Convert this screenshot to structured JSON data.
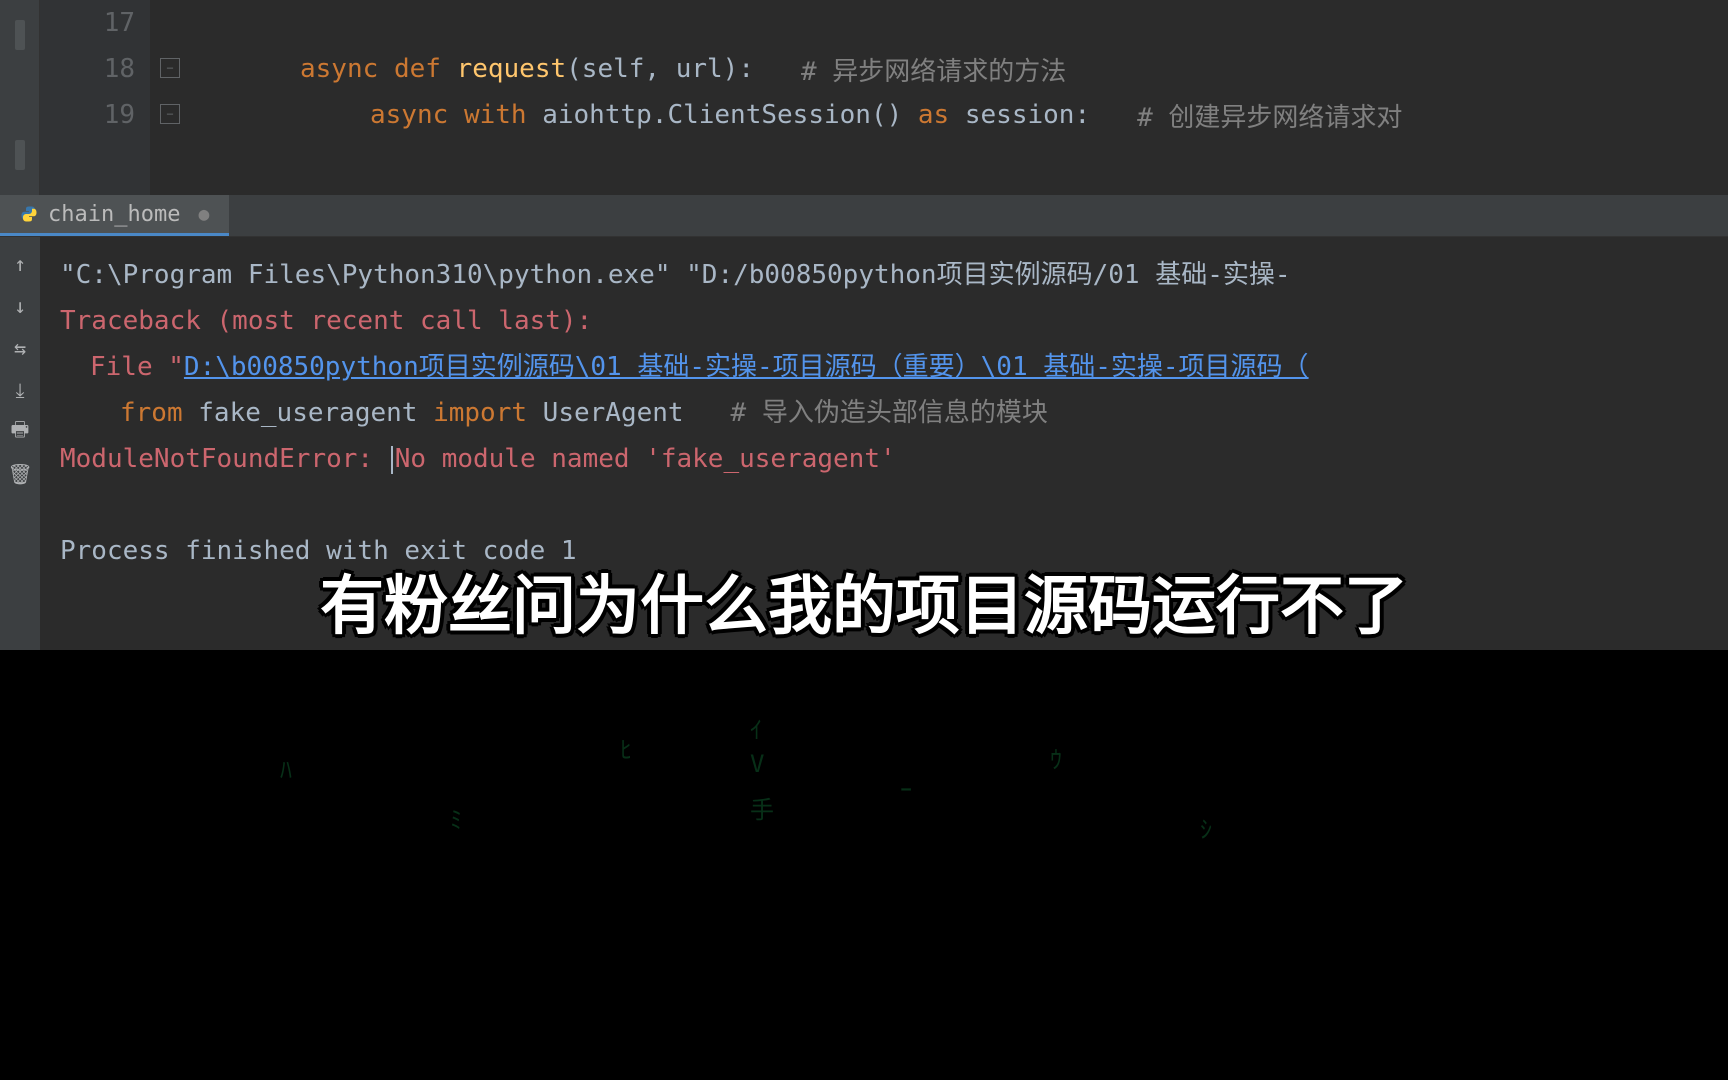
{
  "editor": {
    "lines": [
      {
        "num": "17",
        "content": ""
      },
      {
        "num": "18",
        "content": "async def request(self, url):  # 异步网络请求的方法"
      },
      {
        "num": "19",
        "content": "async with aiohttp.ClientSession() as session:  # 创建异步网络请求对"
      }
    ],
    "tokens": {
      "line18": {
        "async": "async",
        "def": "def",
        "fn": "request",
        "params": "(self, url):",
        "comment": "# 异步网络请求的方法"
      },
      "line19": {
        "async": "async",
        "with": "with",
        "call": "aiohttp.ClientSession()",
        "as": "as",
        "var": "session:",
        "comment": "# 创建异步网络请求对"
      }
    }
  },
  "tab": {
    "name": "chain_home"
  },
  "console": {
    "command": "\"C:\\Program Files\\Python310\\python.exe\" \"D:/b00850python项目实例源码/01 基础-实操-",
    "traceback": "Traceback (most recent call last):",
    "file_prefix": "File \"",
    "file_path": "D:\\b00850python项目实例源码\\01 基础-实操-项目源码（重要）\\01 基础-实操-项目源码（",
    "import_from": "from",
    "import_module": "fake_useragent",
    "import_kw": "import",
    "import_class": "UserAgent",
    "import_comment": "# 导入伪造头部信息的模块",
    "error_name": "ModuleNotFoundError:",
    "error_msg": "No module named 'fake_useragent'",
    "process": "Process finished with exit code 1"
  },
  "subtitle": "有粉丝问为什么我的项目源码运行不了"
}
